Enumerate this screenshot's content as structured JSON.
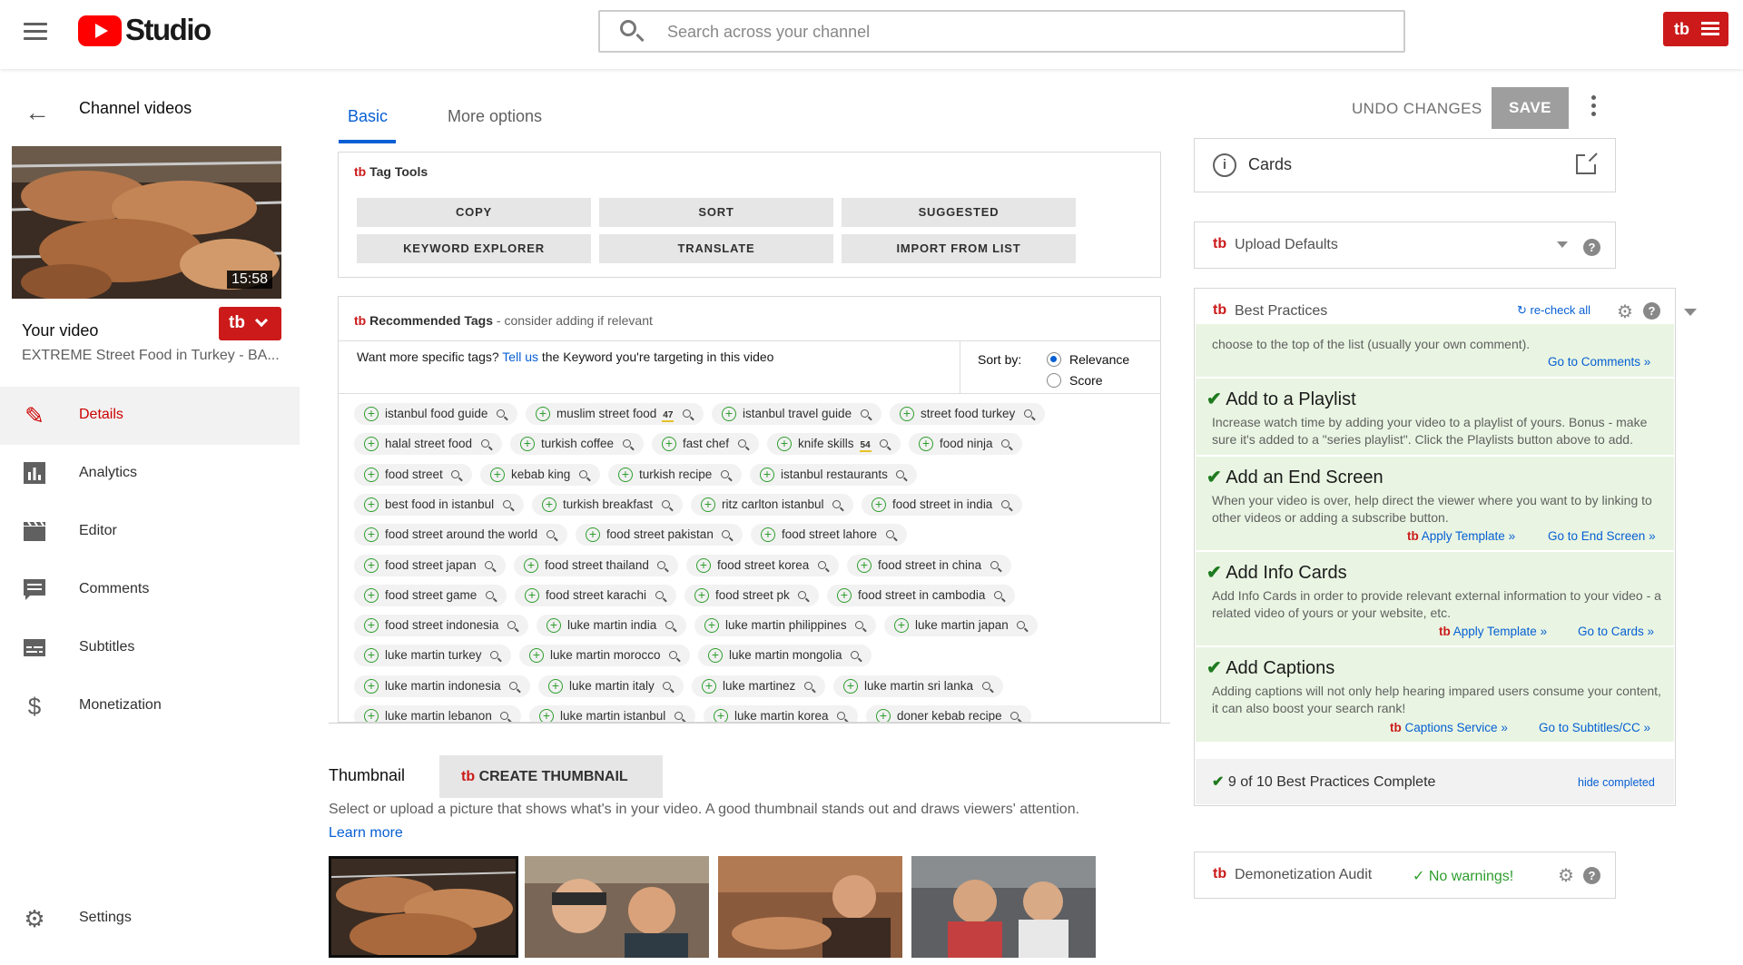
{
  "topbar": {
    "app_name": "Studio",
    "search_placeholder": "Search across your channel",
    "tb_label": "tb"
  },
  "sidebar": {
    "back_title": "Channel videos",
    "video_duration": "15:58",
    "your_video_label": "Your video",
    "video_title": "EXTREME Street Food in Turkey - BA...",
    "tb_label": "tb",
    "nav": [
      {
        "label": "Details",
        "icon": "pencil-icon"
      },
      {
        "label": "Analytics",
        "icon": "bar-chart-icon"
      },
      {
        "label": "Editor",
        "icon": "clapper-icon"
      },
      {
        "label": "Comments",
        "icon": "comment-icon"
      },
      {
        "label": "Subtitles",
        "icon": "subtitles-icon"
      },
      {
        "label": "Monetization",
        "icon": "dollar-icon"
      }
    ],
    "settings_label": "Settings"
  },
  "tabs": {
    "basic": "Basic",
    "more": "More options",
    "undo": "UNDO CHANGES",
    "save": "SAVE"
  },
  "tag_tools": {
    "title": "Tag Tools",
    "buttons": [
      "COPY",
      "SORT",
      "SUGGESTED",
      "KEYWORD EXPLORER",
      "TRANSLATE",
      "IMPORT FROM LIST"
    ]
  },
  "recommended": {
    "title": "Recommended Tags",
    "subtitle": " - consider adding if relevant",
    "prompt_before": "Want more specific tags? ",
    "prompt_link": "Tell us",
    "prompt_after": " the Keyword you're targeting in this video",
    "sort_label": "Sort by:",
    "sort_options": [
      "Relevance",
      "Score"
    ],
    "rows": [
      [
        {
          "t": "istanbul food guide"
        },
        {
          "t": "muslim street food",
          "n": "47"
        },
        {
          "t": "istanbul travel guide"
        },
        {
          "t": "street food turkey"
        }
      ],
      [
        {
          "t": "halal street food"
        },
        {
          "t": "turkish coffee"
        },
        {
          "t": "fast chef"
        },
        {
          "t": "knife skills",
          "n": "54"
        },
        {
          "t": "food ninja"
        }
      ],
      [
        {
          "t": "food street"
        },
        {
          "t": "kebab king"
        },
        {
          "t": "turkish recipe"
        },
        {
          "t": "istanbul restaurants"
        }
      ],
      [
        {
          "t": "best food in istanbul"
        },
        {
          "t": "turkish breakfast"
        },
        {
          "t": "ritz carlton istanbul"
        },
        {
          "t": "food street in india"
        }
      ],
      [
        {
          "t": "food street around the world"
        },
        {
          "t": "food street pakistan"
        },
        {
          "t": "food street lahore"
        }
      ],
      [
        {
          "t": "food street japan"
        },
        {
          "t": "food street thailand"
        },
        {
          "t": "food street korea"
        },
        {
          "t": "food street in china"
        }
      ],
      [
        {
          "t": "food street game"
        },
        {
          "t": "food street karachi"
        },
        {
          "t": "food street pk"
        },
        {
          "t": "food street in cambodia"
        }
      ],
      [
        {
          "t": "food street indonesia"
        },
        {
          "t": "luke martin india"
        },
        {
          "t": "luke martin philippines"
        },
        {
          "t": "luke martin japan"
        }
      ],
      [
        {
          "t": "luke martin turkey"
        },
        {
          "t": "luke martin morocco"
        },
        {
          "t": "luke martin mongolia"
        }
      ],
      [
        {
          "t": "luke martin indonesia"
        },
        {
          "t": "luke martin italy"
        },
        {
          "t": "luke martinez"
        },
        {
          "t": "luke martin sri lanka"
        }
      ],
      [
        {
          "t": "luke martin lebanon"
        },
        {
          "t": "luke martin istanbul"
        },
        {
          "t": "luke martin korea"
        },
        {
          "t": "doner kebab recipe"
        }
      ]
    ]
  },
  "thumbnail": {
    "title": "Thumbnail",
    "create_btn": "CREATE THUMBNAIL",
    "desc": "Select or upload a picture that shows what's in your video. A good thumbnail stands out and draws viewers' attention.",
    "learn_more": "Learn more"
  },
  "right": {
    "cards_label": "Cards",
    "upload_defaults": "Upload Defaults",
    "best_practices": "Best Practices",
    "recheck": "re-check all",
    "partial_desc": "choose to the top of the list (usually your own comment).",
    "goto_comments": "Go to Comments »",
    "items": [
      {
        "title": "Add to a Playlist",
        "desc": "Increase watch time by adding your video to a playlist of yours. Bonus - make sure it's added to a \"series playlist\". Click the Playlists button above to add.",
        "links": []
      },
      {
        "title": "Add an End Screen",
        "desc": "When your video is over, help direct the viewer where you want to by linking to other videos or adding a subscribe button.",
        "links": [
          "Apply Template »",
          "Go to End Screen »"
        ]
      },
      {
        "title": "Add Info Cards",
        "desc": "Add Info Cards in order to provide relevant external information to your video - a related video of yours or your website, etc.",
        "links": [
          "Apply Template »",
          "Go to Cards »"
        ]
      },
      {
        "title": "Add Captions",
        "desc": "Adding captions will not only help hearing impared users consume your content, it can also boost your search rank!",
        "links": [
          "Captions Service »",
          "Go to Subtitles/CC »"
        ]
      }
    ],
    "complete_text": "9 of 10 Best Practices Complete",
    "hide_completed": "hide completed",
    "demonetization": "Demonetization Audit",
    "no_warnings": "No warnings!"
  },
  "colors": {
    "accent": "#065fd4",
    "brand_red": "#cc1a1a",
    "youtube_red": "#ff0000",
    "bp_green": "#e9f5e2"
  }
}
